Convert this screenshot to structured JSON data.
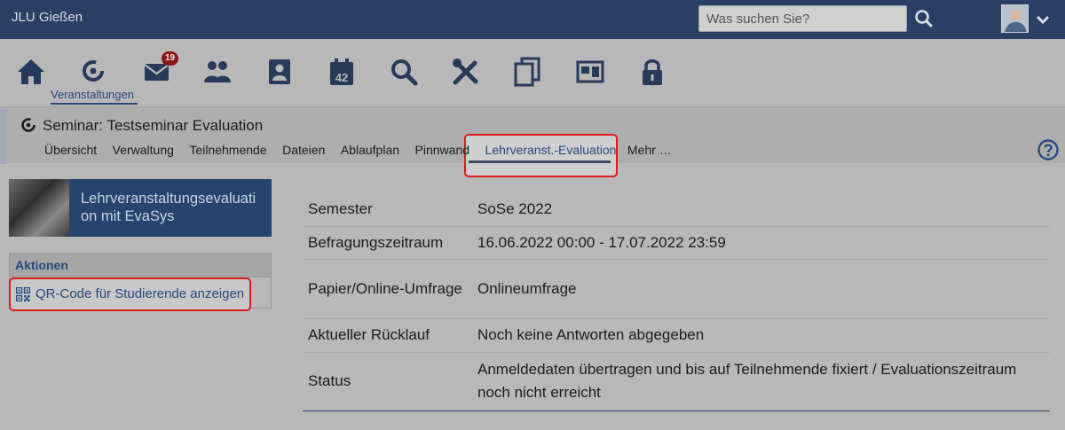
{
  "header": {
    "brand": "JLU Gießen",
    "search_placeholder": "Was suchen Sie?"
  },
  "nav": {
    "active_label": "Veranstaltungen",
    "messages_badge": "19",
    "icons": [
      "home-icon",
      "courses-icon",
      "messages-icon",
      "community-icon",
      "profile-icon",
      "schedule-icon",
      "search-icon",
      "tools-icon",
      "files-icon",
      "admin-icon",
      "lock-icon"
    ],
    "calendar_day": "42"
  },
  "course": {
    "title": "Seminar: Testseminar Evaluation",
    "tabs": [
      "Übersicht",
      "Verwaltung",
      "Teilnehmende",
      "Dateien",
      "Ablaufplan",
      "Pinnwand",
      "Lehrveranst.-Evaluation",
      "Mehr …"
    ],
    "active_tab": "Lehrveranst.-Evaluation"
  },
  "sidebar": {
    "banner_text": "Lehrveranstaltungsevaluation mit EvaSys",
    "actions_title": "Aktionen",
    "actions": [
      {
        "label": "QR-Code für Studierende anzeigen",
        "icon": "qr-code-icon"
      }
    ]
  },
  "details": [
    {
      "label": "Semester",
      "value": "SoSe 2022"
    },
    {
      "label": "Befragungszeitraum",
      "value": "16.06.2022 00:00 - 17.07.2022 23:59"
    },
    {
      "label": "Papier/Online-Umfrage",
      "value": "Onlineumfrage"
    },
    {
      "label": "Aktueller Rücklauf",
      "value": "Noch keine Antworten abgegeben"
    },
    {
      "label": "Status",
      "value": "Anmeldedaten übertragen und bis auf Teilnehmende fixiert / Evaluationszeitraum noch nicht erreicht"
    }
  ],
  "colors": {
    "topbar": "#2a3f63",
    "link": "#28497c",
    "highlight_border": "#e01b1b",
    "badge": "#8b1414"
  }
}
